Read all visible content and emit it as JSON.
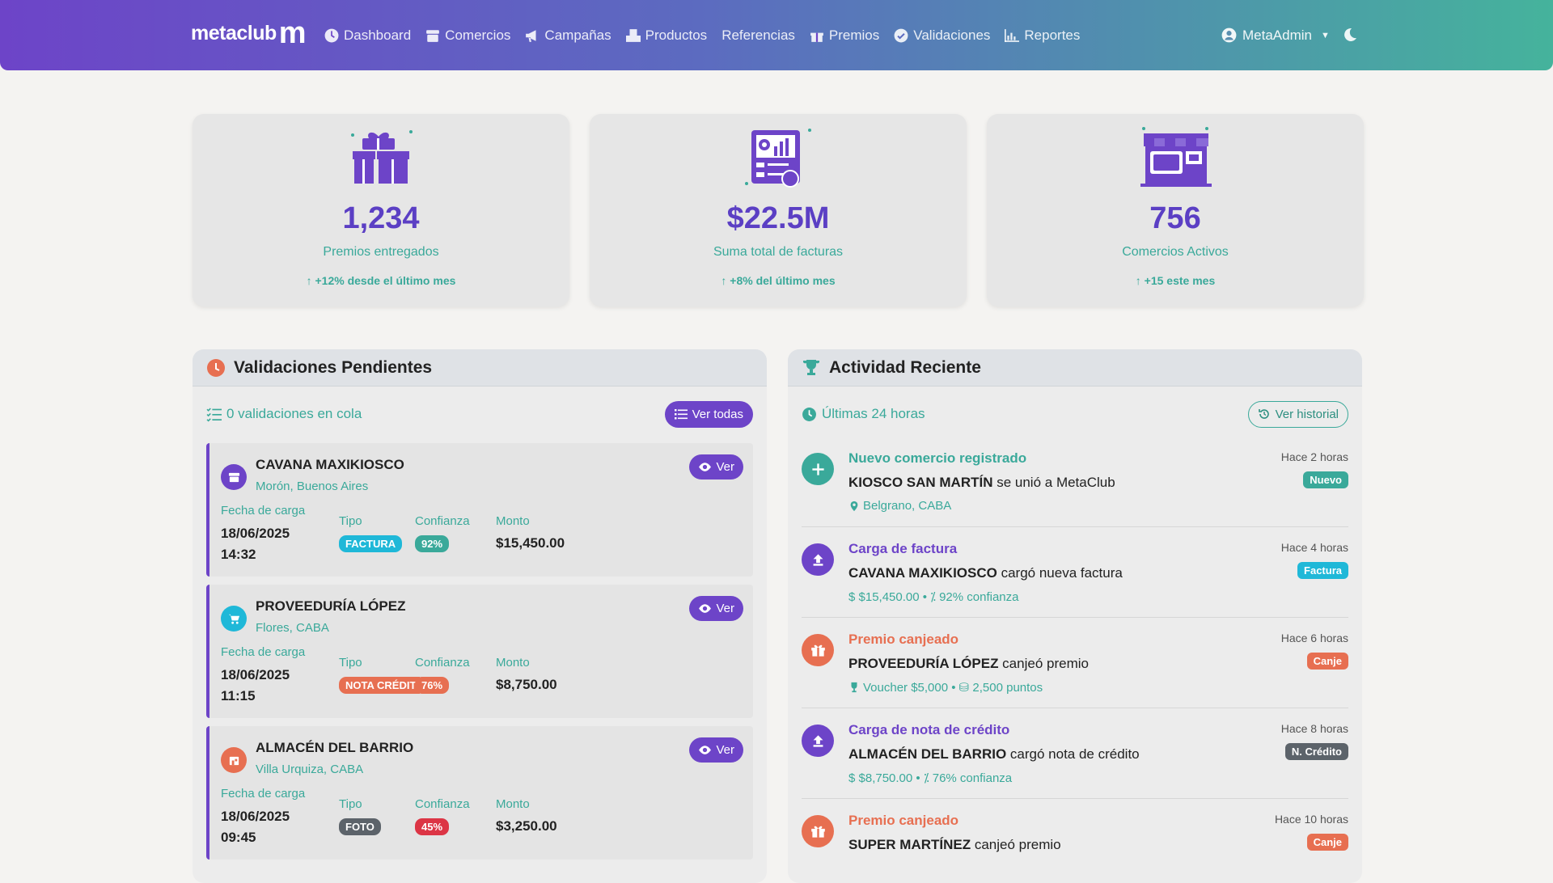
{
  "nav": {
    "brand": "metaclub",
    "brand_mark": "m",
    "items": [
      {
        "label": "Dashboard",
        "icon": "speedometer-icon"
      },
      {
        "label": "Comercios",
        "icon": "store-icon"
      },
      {
        "label": "Campañas",
        "icon": "megaphone-icon"
      },
      {
        "label": "Productos",
        "icon": "boxes-icon"
      },
      {
        "label": "Referencias",
        "icon": ""
      },
      {
        "label": "Premios",
        "icon": "gift-icon"
      },
      {
        "label": "Validaciones",
        "icon": "check-circle-icon"
      },
      {
        "label": "Reportes",
        "icon": "bar-chart-icon"
      }
    ],
    "user": "MetaAdmin"
  },
  "stats": [
    {
      "value": "1,234",
      "label": "Premios entregados",
      "trend": "+12% desde el último mes"
    },
    {
      "value": "$22.5M",
      "label": "Suma total de facturas",
      "trend": "+8% del último mes"
    },
    {
      "value": "756",
      "label": "Comercios Activos",
      "trend": "+15 este mes"
    }
  ],
  "validations": {
    "title": "Validaciones Pendientes",
    "queue": "0 validaciones en cola",
    "view_all": "Ver todas",
    "labels": {
      "fecha": "Fecha de carga",
      "tipo": "Tipo",
      "confianza": "Confianza",
      "monto": "Monto",
      "ver": "Ver"
    },
    "items": [
      {
        "name": "CAVANA MAXIKIOSCO",
        "location": "Morón, Buenos Aires",
        "date": "18/06/2025",
        "time": "14:32",
        "type": "FACTURA",
        "type_color": "#1fb8d8",
        "confidence": "92%",
        "conf_color": "#3aa99a",
        "amount": "$15,450.00",
        "avatar_color": "#6d44c8",
        "avatar_icon": "store-icon"
      },
      {
        "name": "PROVEEDURÍA LÓPEZ",
        "location": "Flores, CABA",
        "date": "18/06/2025",
        "time": "11:15",
        "type": "NOTA CRÉDITO",
        "type_color": "#e76f51",
        "confidence": "76%",
        "conf_color": "#e76f51",
        "amount": "$8,750.00",
        "avatar_color": "#1fb8d8",
        "avatar_icon": "cart-icon"
      },
      {
        "name": "ALMACÉN DEL BARRIO",
        "location": "Villa Urquiza, CABA",
        "date": "18/06/2025",
        "time": "09:45",
        "type": "FOTO",
        "type_color": "#5c636a",
        "confidence": "45%",
        "conf_color": "#dc3545",
        "amount": "$3,250.00",
        "avatar_color": "#e76f51",
        "avatar_icon": "shop-icon"
      }
    ]
  },
  "activity": {
    "title": "Actividad Reciente",
    "range": "Últimas 24 horas",
    "history": "Ver historial",
    "items": [
      {
        "title": "Nuevo comercio registrado",
        "title_color": "#3aa99a",
        "avatar_color": "#3aa99a",
        "avatar_icon": "plus-icon",
        "strong": "KIOSCO SAN MARTÍN",
        "rest": " se unió a MetaClub",
        "meta": "Belgrano, CABA",
        "meta_icon": "pin-icon",
        "time": "Hace 2 horas",
        "badge": "Nuevo",
        "badge_color": "#3aa99a"
      },
      {
        "title": "Carga de factura",
        "title_color": "#6d44c8",
        "avatar_color": "#6d44c8",
        "avatar_icon": "upload-icon",
        "strong": "CAVANA MAXIKIOSCO",
        "rest": " cargó nueva factura",
        "meta": "$ $15,450.00 • ⁒ 92% confianza",
        "meta_icon": "",
        "time": "Hace 4 horas",
        "badge": "Factura",
        "badge_color": "#1fb8d8"
      },
      {
        "title": "Premio canjeado",
        "title_color": "#e76f51",
        "avatar_color": "#e76f51",
        "avatar_icon": "gift-icon",
        "strong": "PROVEEDURÍA LÓPEZ",
        "rest": " canjeó premio",
        "meta": "Voucher $5,000 • ⛁ 2,500 puntos",
        "meta_icon": "trophy-icon",
        "time": "Hace 6 horas",
        "badge": "Canje",
        "badge_color": "#e76f51"
      },
      {
        "title": "Carga de nota de crédito",
        "title_color": "#6d44c8",
        "avatar_color": "#6d44c8",
        "avatar_icon": "upload-icon",
        "strong": "ALMACÉN DEL BARRIO",
        "rest": " cargó nota de crédito",
        "meta": "$ $8,750.00 • ⁒ 76% confianza",
        "meta_icon": "",
        "time": "Hace 8 horas",
        "badge": "N. Crédito",
        "badge_color": "#5c636a"
      },
      {
        "title": "Premio canjeado",
        "title_color": "#e76f51",
        "avatar_color": "#e76f51",
        "avatar_icon": "gift-icon",
        "strong": "SUPER MARTÍNEZ",
        "rest": " canjeó premio",
        "meta": "",
        "meta_icon": "",
        "time": "Hace 10 horas",
        "badge": "Canje",
        "badge_color": "#e76f51"
      }
    ]
  }
}
